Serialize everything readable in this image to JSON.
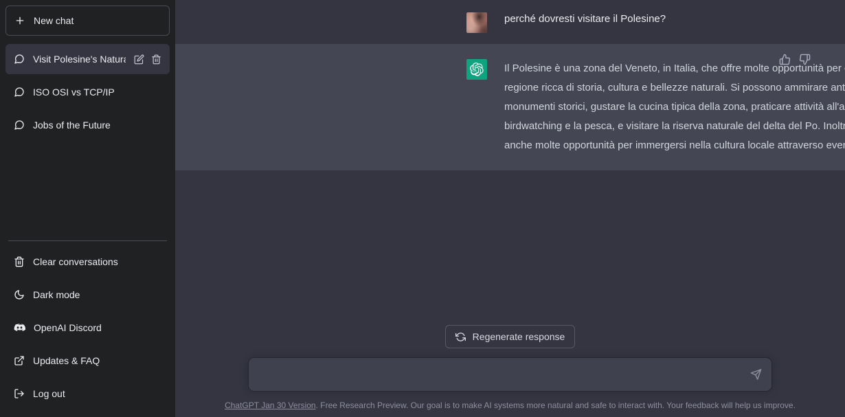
{
  "sidebar": {
    "new_chat_label": "New chat",
    "conversations": [
      {
        "label": "Visit Polesine's Natural",
        "active": true
      },
      {
        "label": "ISO OSI vs TCP/IP",
        "active": false
      },
      {
        "label": "Jobs of the Future",
        "active": false
      }
    ],
    "menu": [
      {
        "label": "Clear conversations",
        "icon": "trash-icon"
      },
      {
        "label": "Dark mode",
        "icon": "moon-icon"
      },
      {
        "label": "OpenAI Discord",
        "icon": "discord-icon"
      },
      {
        "label": "Updates & FAQ",
        "icon": "external-link-icon"
      },
      {
        "label": "Log out",
        "icon": "logout-icon"
      }
    ]
  },
  "thread": {
    "user_message": "perché dovresti visitare il Polesine?",
    "assistant_message": "Il Polesine è una zona del Veneto, in Italia, che offre molte opportunità per chi vuole visitare una regione ricca di storia, cultura e bellezze naturali. Si possono ammirare antichi borghi, chiese e monumenti storici, gustare la cucina tipica della zona, praticare attività all'aria aperta come il birdwatching e la pesca, e visitare la riserva naturale del delta del Po. Inoltre, il Polesine offre anche molte opportunità per immergersi nella cultura locale attraverso eventi, tradizioni e arte."
  },
  "composer": {
    "regenerate_label": "Regenerate response",
    "input_value": "",
    "input_placeholder": ""
  },
  "footer": {
    "version_link": "ChatGPT Jan 30 Version",
    "disclaimer": ". Free Research Preview. Our goal is to make AI systems more natural and safe to interact with. Your feedback will help us improve."
  },
  "colors": {
    "sidebar_bg": "#202123",
    "main_bg": "#343541",
    "assistant_bg": "#444654",
    "brand_green": "#10a37f",
    "input_bg": "#40414f"
  }
}
